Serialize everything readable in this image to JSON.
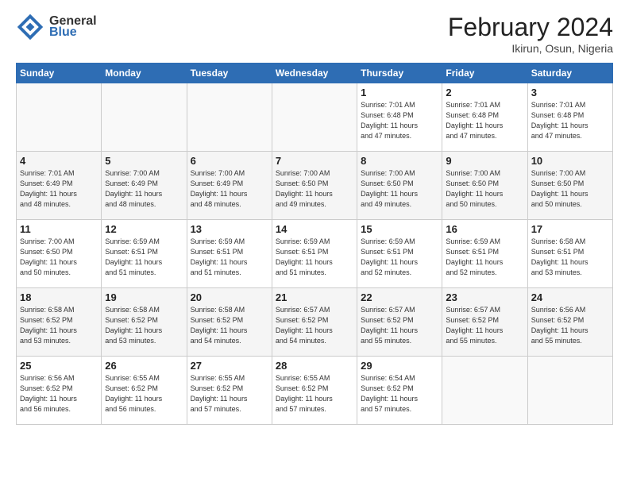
{
  "header": {
    "logo_general": "General",
    "logo_blue": "Blue",
    "month_title": "February 2024",
    "subtitle": "Ikirun, Osun, Nigeria"
  },
  "days_of_week": [
    "Sunday",
    "Monday",
    "Tuesday",
    "Wednesday",
    "Thursday",
    "Friday",
    "Saturday"
  ],
  "weeks": [
    [
      {
        "day": "",
        "info": ""
      },
      {
        "day": "",
        "info": ""
      },
      {
        "day": "",
        "info": ""
      },
      {
        "day": "",
        "info": ""
      },
      {
        "day": "1",
        "info": "Sunrise: 7:01 AM\nSunset: 6:48 PM\nDaylight: 11 hours\nand 47 minutes."
      },
      {
        "day": "2",
        "info": "Sunrise: 7:01 AM\nSunset: 6:48 PM\nDaylight: 11 hours\nand 47 minutes."
      },
      {
        "day": "3",
        "info": "Sunrise: 7:01 AM\nSunset: 6:48 PM\nDaylight: 11 hours\nand 47 minutes."
      }
    ],
    [
      {
        "day": "4",
        "info": "Sunrise: 7:01 AM\nSunset: 6:49 PM\nDaylight: 11 hours\nand 48 minutes."
      },
      {
        "day": "5",
        "info": "Sunrise: 7:00 AM\nSunset: 6:49 PM\nDaylight: 11 hours\nand 48 minutes."
      },
      {
        "day": "6",
        "info": "Sunrise: 7:00 AM\nSunset: 6:49 PM\nDaylight: 11 hours\nand 48 minutes."
      },
      {
        "day": "7",
        "info": "Sunrise: 7:00 AM\nSunset: 6:50 PM\nDaylight: 11 hours\nand 49 minutes."
      },
      {
        "day": "8",
        "info": "Sunrise: 7:00 AM\nSunset: 6:50 PM\nDaylight: 11 hours\nand 49 minutes."
      },
      {
        "day": "9",
        "info": "Sunrise: 7:00 AM\nSunset: 6:50 PM\nDaylight: 11 hours\nand 50 minutes."
      },
      {
        "day": "10",
        "info": "Sunrise: 7:00 AM\nSunset: 6:50 PM\nDaylight: 11 hours\nand 50 minutes."
      }
    ],
    [
      {
        "day": "11",
        "info": "Sunrise: 7:00 AM\nSunset: 6:50 PM\nDaylight: 11 hours\nand 50 minutes."
      },
      {
        "day": "12",
        "info": "Sunrise: 6:59 AM\nSunset: 6:51 PM\nDaylight: 11 hours\nand 51 minutes."
      },
      {
        "day": "13",
        "info": "Sunrise: 6:59 AM\nSunset: 6:51 PM\nDaylight: 11 hours\nand 51 minutes."
      },
      {
        "day": "14",
        "info": "Sunrise: 6:59 AM\nSunset: 6:51 PM\nDaylight: 11 hours\nand 51 minutes."
      },
      {
        "day": "15",
        "info": "Sunrise: 6:59 AM\nSunset: 6:51 PM\nDaylight: 11 hours\nand 52 minutes."
      },
      {
        "day": "16",
        "info": "Sunrise: 6:59 AM\nSunset: 6:51 PM\nDaylight: 11 hours\nand 52 minutes."
      },
      {
        "day": "17",
        "info": "Sunrise: 6:58 AM\nSunset: 6:51 PM\nDaylight: 11 hours\nand 53 minutes."
      }
    ],
    [
      {
        "day": "18",
        "info": "Sunrise: 6:58 AM\nSunset: 6:52 PM\nDaylight: 11 hours\nand 53 minutes."
      },
      {
        "day": "19",
        "info": "Sunrise: 6:58 AM\nSunset: 6:52 PM\nDaylight: 11 hours\nand 53 minutes."
      },
      {
        "day": "20",
        "info": "Sunrise: 6:58 AM\nSunset: 6:52 PM\nDaylight: 11 hours\nand 54 minutes."
      },
      {
        "day": "21",
        "info": "Sunrise: 6:57 AM\nSunset: 6:52 PM\nDaylight: 11 hours\nand 54 minutes."
      },
      {
        "day": "22",
        "info": "Sunrise: 6:57 AM\nSunset: 6:52 PM\nDaylight: 11 hours\nand 55 minutes."
      },
      {
        "day": "23",
        "info": "Sunrise: 6:57 AM\nSunset: 6:52 PM\nDaylight: 11 hours\nand 55 minutes."
      },
      {
        "day": "24",
        "info": "Sunrise: 6:56 AM\nSunset: 6:52 PM\nDaylight: 11 hours\nand 55 minutes."
      }
    ],
    [
      {
        "day": "25",
        "info": "Sunrise: 6:56 AM\nSunset: 6:52 PM\nDaylight: 11 hours\nand 56 minutes."
      },
      {
        "day": "26",
        "info": "Sunrise: 6:55 AM\nSunset: 6:52 PM\nDaylight: 11 hours\nand 56 minutes."
      },
      {
        "day": "27",
        "info": "Sunrise: 6:55 AM\nSunset: 6:52 PM\nDaylight: 11 hours\nand 57 minutes."
      },
      {
        "day": "28",
        "info": "Sunrise: 6:55 AM\nSunset: 6:52 PM\nDaylight: 11 hours\nand 57 minutes."
      },
      {
        "day": "29",
        "info": "Sunrise: 6:54 AM\nSunset: 6:52 PM\nDaylight: 11 hours\nand 57 minutes."
      },
      {
        "day": "",
        "info": ""
      },
      {
        "day": "",
        "info": ""
      }
    ]
  ]
}
